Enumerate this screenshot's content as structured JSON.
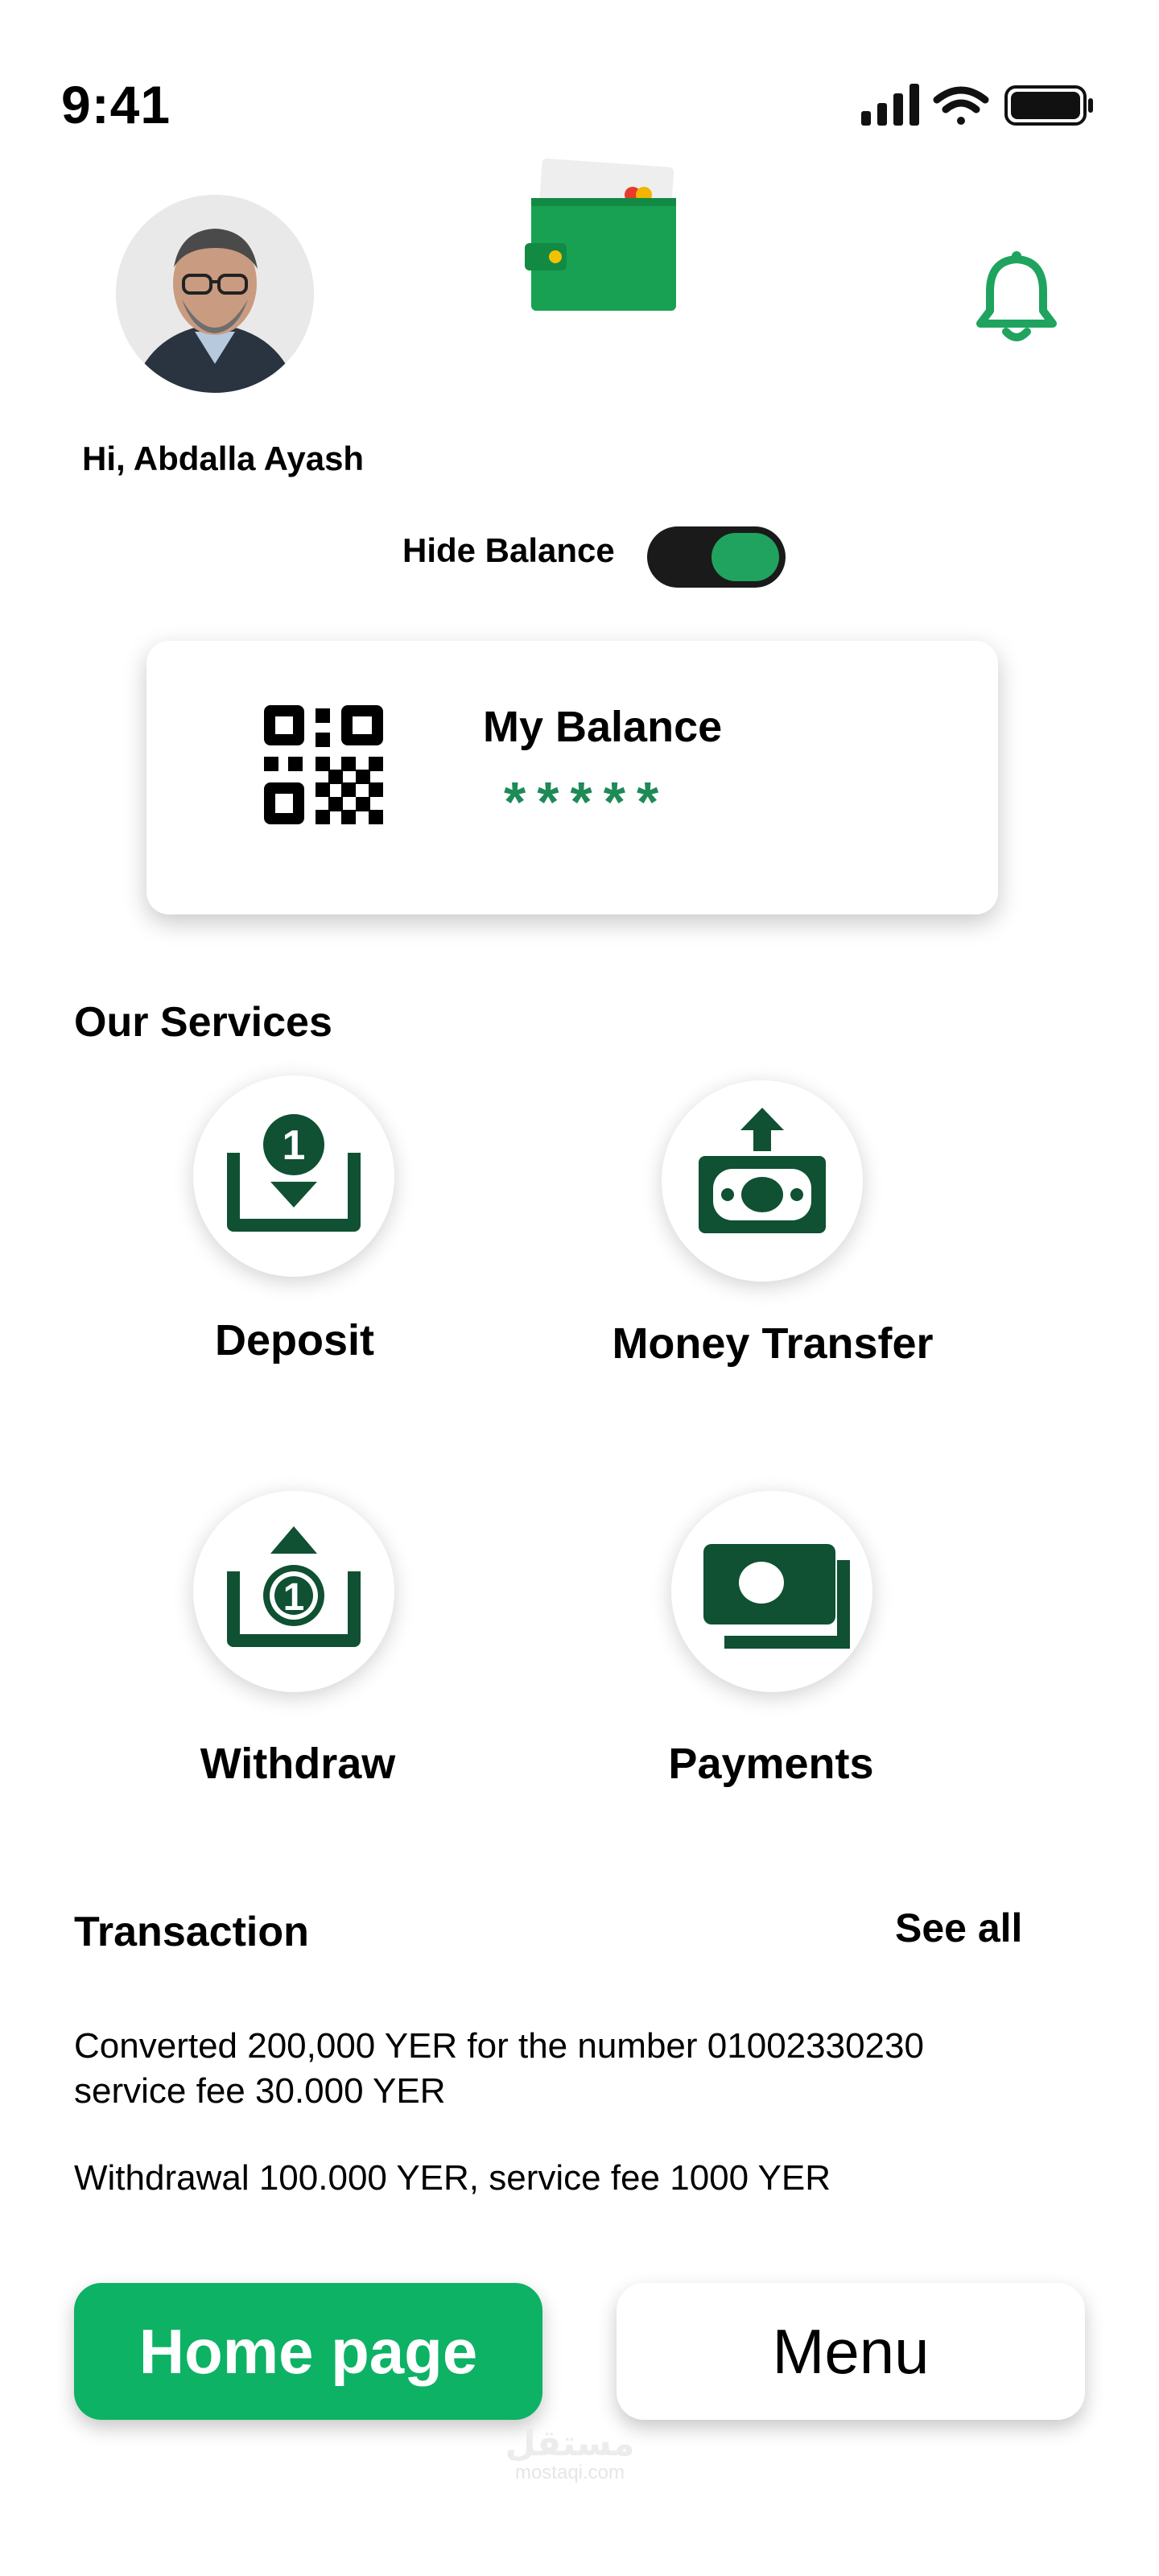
{
  "status_bar": {
    "time": "9:41",
    "icons": [
      "signal-icon",
      "wifi-icon",
      "battery-icon"
    ]
  },
  "header": {
    "greeting": "Hi, Abdalla Ayash",
    "avatar_icon": "avatar",
    "logo_icon": "wallet-icon",
    "notification_icon": "bell-icon"
  },
  "balance_toggle": {
    "label": "Hide Balance",
    "on": true
  },
  "balance_card": {
    "title": "My Balance",
    "masked_value": "*****",
    "qr_icon": "qr-code-icon"
  },
  "services": {
    "title": "Our Services",
    "items": [
      {
        "label": "Deposit",
        "icon": "deposit-icon"
      },
      {
        "label": "Money Transfer",
        "icon": "money-transfer-icon"
      },
      {
        "label": "Withdraw",
        "icon": "withdraw-icon"
      },
      {
        "label": "Payments",
        "icon": "payments-icon"
      }
    ]
  },
  "transactions": {
    "title": "Transaction",
    "see_all": "See all",
    "items": [
      {
        "line1": "Converted 200,000 YER for the number 01002330230",
        "line2": "service fee 30.000 YER"
      },
      {
        "line1": "Withdrawal 100.000 YER, service fee 1000 YER"
      }
    ]
  },
  "bottom_nav": {
    "home_label": "Home page",
    "menu_label": "Menu"
  },
  "watermark": {
    "arabic": "مستقل",
    "site": "mostaqi.com"
  },
  "colors": {
    "primary_green": "#0db265",
    "dark_green": "#0f5132",
    "accent_green": "#1fa35f"
  }
}
